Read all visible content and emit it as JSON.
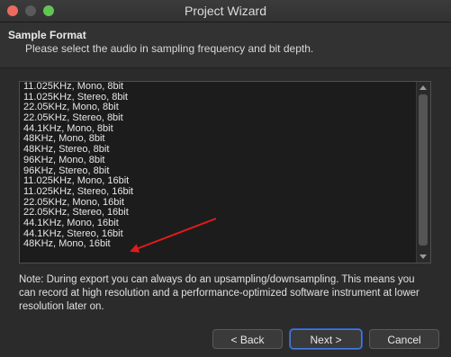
{
  "window": {
    "title": "Project Wizard",
    "colors": {
      "arrow": "#e01b1b",
      "close": "#ec6a5e",
      "maximize": "#61c554",
      "default_button_border": "#4a7ad8"
    }
  },
  "header": {
    "title": "Sample Format",
    "subtitle": "Please select the audio in sampling frequency and bit depth."
  },
  "list": {
    "items": [
      "11.025KHz, Mono, 8bit",
      "11.025KHz, Stereo, 8bit",
      "22.05KHz, Mono, 8bit",
      "22.05KHz, Stereo, 8bit",
      "44.1KHz, Mono, 8bit",
      "48KHz, Mono, 8bit",
      "48KHz, Stereo, 8bit",
      "96KHz, Mono, 8bit",
      "96KHz, Stereo, 8bit",
      "11.025KHz, Mono, 16bit",
      "11.025KHz, Stereo, 16bit",
      "22.05KHz, Mono, 16bit",
      "22.05KHz, Stereo, 16bit",
      "44.1KHz, Mono, 16bit",
      "44.1KHz, Stereo, 16bit",
      "48KHz, Mono, 16bit"
    ],
    "highlighted_item": "44.1KHz, Stereo, 16bit"
  },
  "note": "Note: During export you can always do an upsampling/downsampling. This means you can record at high resolution and a performance-optimized software instrument at lower resolution later on.",
  "buttons": {
    "back": "< Back",
    "next": "Next >",
    "cancel": "Cancel"
  }
}
